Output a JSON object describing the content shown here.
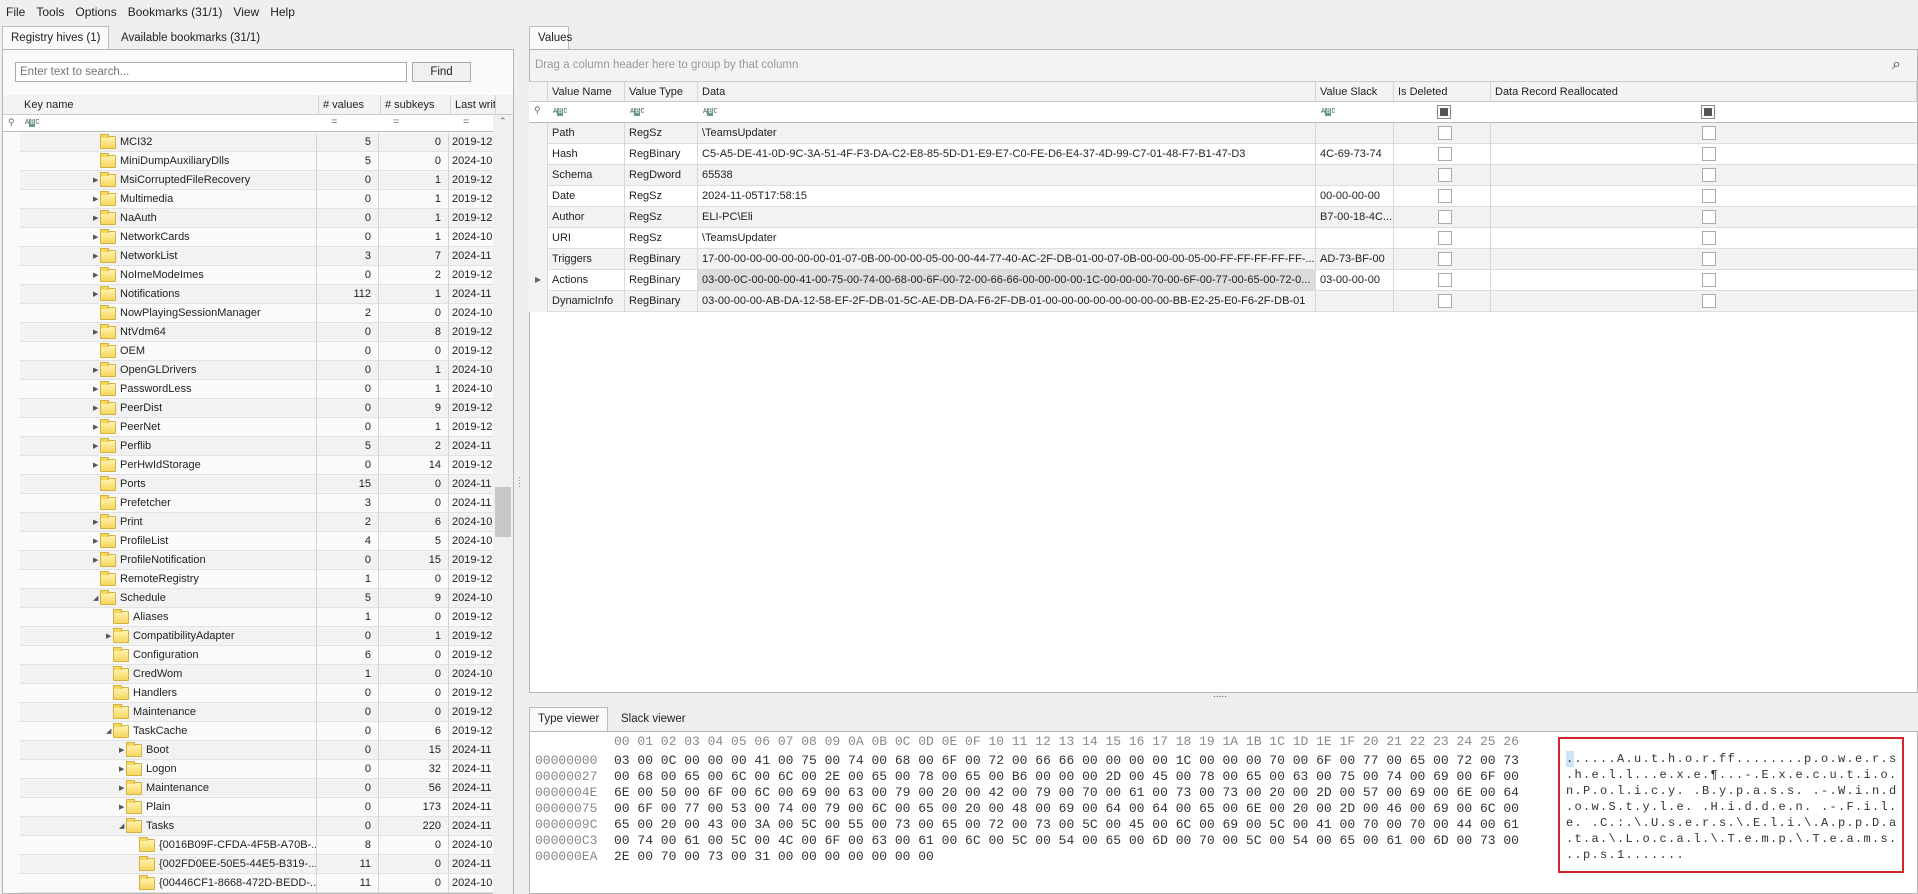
{
  "menu": [
    "File",
    "Tools",
    "Options",
    "Bookmarks (31/1)",
    "View",
    "Help"
  ],
  "left_tabs": {
    "hives": "Registry hives (1)",
    "bookmarks": "Available bookmarks (31/1)"
  },
  "search": {
    "placeholder": "Enter text to search...",
    "find_label": "Find"
  },
  "tree": {
    "columns": {
      "key_name": "Key name",
      "values": "# values",
      "subkeys": "# subkeys",
      "last_write": "Last write tim"
    },
    "filter_eq": "=",
    "rows": [
      {
        "level": 0,
        "exp": "none",
        "name": "MCI32",
        "values": "5",
        "subkeys": "0",
        "lw": "2019-12"
      },
      {
        "level": 0,
        "exp": "none",
        "name": "MiniDumpAuxiliaryDlls",
        "values": "5",
        "subkeys": "0",
        "lw": "2024-10"
      },
      {
        "level": 0,
        "exp": "collapsed",
        "name": "MsiCorruptedFileRecovery",
        "values": "0",
        "subkeys": "1",
        "lw": "2019-12"
      },
      {
        "level": 0,
        "exp": "collapsed",
        "name": "Multimedia",
        "values": "0",
        "subkeys": "1",
        "lw": "2019-12"
      },
      {
        "level": 0,
        "exp": "collapsed",
        "name": "NaAuth",
        "values": "0",
        "subkeys": "1",
        "lw": "2019-12"
      },
      {
        "level": 0,
        "exp": "collapsed",
        "name": "NetworkCards",
        "values": "0",
        "subkeys": "1",
        "lw": "2024-10"
      },
      {
        "level": 0,
        "exp": "collapsed",
        "name": "NetworkList",
        "values": "3",
        "subkeys": "7",
        "lw": "2024-11"
      },
      {
        "level": 0,
        "exp": "collapsed",
        "name": "NoImeModeImes",
        "values": "0",
        "subkeys": "2",
        "lw": "2019-12"
      },
      {
        "level": 0,
        "exp": "collapsed",
        "name": "Notifications",
        "values": "112",
        "subkeys": "1",
        "lw": "2024-11"
      },
      {
        "level": 0,
        "exp": "none",
        "name": "NowPlayingSessionManager",
        "values": "2",
        "subkeys": "0",
        "lw": "2024-10"
      },
      {
        "level": 0,
        "exp": "collapsed",
        "name": "NtVdm64",
        "values": "0",
        "subkeys": "8",
        "lw": "2019-12"
      },
      {
        "level": 0,
        "exp": "none",
        "name": "OEM",
        "values": "0",
        "subkeys": "0",
        "lw": "2019-12"
      },
      {
        "level": 0,
        "exp": "collapsed",
        "name": "OpenGLDrivers",
        "values": "0",
        "subkeys": "1",
        "lw": "2024-10"
      },
      {
        "level": 0,
        "exp": "collapsed",
        "name": "PasswordLess",
        "values": "0",
        "subkeys": "1",
        "lw": "2024-10"
      },
      {
        "level": 0,
        "exp": "collapsed",
        "name": "PeerDist",
        "values": "0",
        "subkeys": "9",
        "lw": "2019-12"
      },
      {
        "level": 0,
        "exp": "collapsed",
        "name": "PeerNet",
        "values": "0",
        "subkeys": "1",
        "lw": "2019-12"
      },
      {
        "level": 0,
        "exp": "collapsed",
        "name": "Perflib",
        "values": "5",
        "subkeys": "2",
        "lw": "2024-11"
      },
      {
        "level": 0,
        "exp": "collapsed",
        "name": "PerHwIdStorage",
        "values": "0",
        "subkeys": "14",
        "lw": "2019-12"
      },
      {
        "level": 0,
        "exp": "none",
        "name": "Ports",
        "values": "15",
        "subkeys": "0",
        "lw": "2024-11"
      },
      {
        "level": 0,
        "exp": "none",
        "name": "Prefetcher",
        "values": "3",
        "subkeys": "0",
        "lw": "2024-11"
      },
      {
        "level": 0,
        "exp": "collapsed",
        "name": "Print",
        "values": "2",
        "subkeys": "6",
        "lw": "2024-10"
      },
      {
        "level": 0,
        "exp": "collapsed",
        "name": "ProfileList",
        "values": "4",
        "subkeys": "5",
        "lw": "2024-10"
      },
      {
        "level": 0,
        "exp": "collapsed",
        "name": "ProfileNotification",
        "values": "0",
        "subkeys": "15",
        "lw": "2019-12"
      },
      {
        "level": 0,
        "exp": "none",
        "name": "RemoteRegistry",
        "values": "1",
        "subkeys": "0",
        "lw": "2019-12"
      },
      {
        "level": 0,
        "exp": "expanded",
        "name": "Schedule",
        "values": "5",
        "subkeys": "9",
        "lw": "2024-10"
      },
      {
        "level": 1,
        "exp": "none",
        "name": "Aliases",
        "values": "1",
        "subkeys": "0",
        "lw": "2019-12"
      },
      {
        "level": 1,
        "exp": "collapsed",
        "name": "CompatibilityAdapter",
        "values": "0",
        "subkeys": "1",
        "lw": "2019-12"
      },
      {
        "level": 1,
        "exp": "none",
        "name": "Configuration",
        "values": "6",
        "subkeys": "0",
        "lw": "2019-12"
      },
      {
        "level": 1,
        "exp": "none",
        "name": "CredWom",
        "values": "1",
        "subkeys": "0",
        "lw": "2024-10"
      },
      {
        "level": 1,
        "exp": "none",
        "name": "Handlers",
        "values": "0",
        "subkeys": "0",
        "lw": "2019-12"
      },
      {
        "level": 1,
        "exp": "none",
        "name": "Maintenance",
        "values": "0",
        "subkeys": "0",
        "lw": "2019-12"
      },
      {
        "level": 1,
        "exp": "expanded",
        "name": "TaskCache",
        "values": "0",
        "subkeys": "6",
        "lw": "2019-12"
      },
      {
        "level": 2,
        "exp": "collapsed",
        "name": "Boot",
        "values": "0",
        "subkeys": "15",
        "lw": "2024-11"
      },
      {
        "level": 2,
        "exp": "collapsed",
        "name": "Logon",
        "values": "0",
        "subkeys": "32",
        "lw": "2024-11"
      },
      {
        "level": 2,
        "exp": "collapsed",
        "name": "Maintenance",
        "values": "0",
        "subkeys": "56",
        "lw": "2024-11"
      },
      {
        "level": 2,
        "exp": "collapsed",
        "name": "Plain",
        "values": "0",
        "subkeys": "173",
        "lw": "2024-11"
      },
      {
        "level": 2,
        "exp": "expanded",
        "name": "Tasks",
        "values": "0",
        "subkeys": "220",
        "lw": "2024-11"
      },
      {
        "level": 3,
        "exp": "none",
        "name": "{0016B09F-CFDA-4F5B-A70B-...",
        "values": "8",
        "subkeys": "0",
        "lw": "2024-10"
      },
      {
        "level": 3,
        "exp": "none",
        "name": "{002FD0EE-50E5-44E5-B319-...",
        "values": "11",
        "subkeys": "0",
        "lw": "2024-11"
      },
      {
        "level": 3,
        "exp": "none",
        "name": "{00446CF1-8668-472D-BEDD-...",
        "values": "11",
        "subkeys": "0",
        "lw": "2024-10"
      }
    ]
  },
  "values_tab": "Values",
  "group_hint": "Drag a column header here to group by that column",
  "values": {
    "columns": {
      "name": "Value Name",
      "type": "Value Type",
      "data": "Data",
      "slack": "Value Slack",
      "deleted": "Is Deleted",
      "realloc": "Data Record Reallocated"
    },
    "selected_index": 7,
    "rows": [
      {
        "name": "Path",
        "type": "RegSz",
        "data": "\\TeamsUpdater",
        "slack": "",
        "deleted": false,
        "realloc": false
      },
      {
        "name": "Hash",
        "type": "RegBinary",
        "data": "C5-A5-DE-41-0D-9C-3A-51-4F-F3-DA-C2-E8-85-5D-D1-E9-E7-C0-FE-D6-E4-37-4D-99-C7-01-48-F7-B1-47-D3",
        "slack": "4C-69-73-74",
        "deleted": false,
        "realloc": false
      },
      {
        "name": "Schema",
        "type": "RegDword",
        "data": "65538",
        "slack": "",
        "deleted": false,
        "realloc": false
      },
      {
        "name": "Date",
        "type": "RegSz",
        "data": "2024-11-05T17:58:15",
        "slack": "00-00-00-00",
        "deleted": false,
        "realloc": false
      },
      {
        "name": "Author",
        "type": "RegSz",
        "data": "ELI-PC\\Eli",
        "slack": "B7-00-18-4C...",
        "deleted": false,
        "realloc": false
      },
      {
        "name": "URI",
        "type": "RegSz",
        "data": "\\TeamsUpdater",
        "slack": "",
        "deleted": false,
        "realloc": false
      },
      {
        "name": "Triggers",
        "type": "RegBinary",
        "data": "17-00-00-00-00-00-00-00-01-07-0B-00-00-00-05-00-00-44-77-40-AC-2F-DB-01-00-07-0B-00-00-00-05-00-FF-FF-FF-FF-FF-...",
        "slack": "AD-73-BF-00",
        "deleted": false,
        "realloc": false
      },
      {
        "name": "Actions",
        "type": "RegBinary",
        "data": "03-00-0C-00-00-00-41-00-75-00-74-00-68-00-6F-00-72-00-66-66-00-00-00-00-1C-00-00-00-70-00-6F-00-77-00-65-00-72-0...",
        "slack": "03-00-00-00",
        "deleted": false,
        "realloc": false
      },
      {
        "name": "DynamicInfo",
        "type": "RegBinary",
        "data": "03-00-00-00-AB-DA-12-58-EF-2F-DB-01-5C-AE-DB-DA-F6-2F-DB-01-00-00-00-00-00-00-00-00-BB-E2-25-E0-F6-2F-DB-01",
        "slack": "",
        "deleted": false,
        "realloc": false
      }
    ]
  },
  "splitter_dots": ".....",
  "bottom_tabs": {
    "type_viewer": "Type viewer",
    "slack_viewer": "Slack viewer"
  },
  "hex": {
    "header": "00 01 02 03 04 05 06 07 08 09 0A 0B 0C 0D 0E 0F 10 11 12 13 14 15 16 17 18 19 1A 1B 1C 1D 1E 1F 20 21 22 23 24 25 26",
    "rows": [
      {
        "offset": "00000000",
        "bytes": "03 00 0C 00 00 00 41 00 75 00 74 00 68 00 6F 00 72 00 66 66 00 00 00 00 1C 00 00 00 70 00 6F 00 77 00 65 00 72 00 73"
      },
      {
        "offset": "00000027",
        "bytes": "00 68 00 65 00 6C 00 6C 00 2E 00 65 00 78 00 65 00 B6 00 00 00 2D 00 45 00 78 00 65 00 63 00 75 00 74 00 69 00 6F 00"
      },
      {
        "offset": "0000004E",
        "bytes": "6E 00 50 00 6F 00 6C 00 69 00 63 00 79 00 20 00 42 00 79 00 70 00 61 00 73 00 73 00 20 00 2D 00 57 00 69 00 6E 00 64"
      },
      {
        "offset": "00000075",
        "bytes": "00 6F 00 77 00 53 00 74 00 79 00 6C 00 65 00 20 00 48 00 69 00 64 00 64 00 65 00 6E 00 20 00 2D 00 46 00 69 00 6C 00"
      },
      {
        "offset": "0000009C",
        "bytes": "65 00 20 00 43 00 3A 00 5C 00 55 00 73 00 65 00 72 00 73 00 5C 00 45 00 6C 00 69 00 5C 00 41 00 70 00 70 00 44 00 61"
      },
      {
        "offset": "000000C3",
        "bytes": "00 74 00 61 00 5C 00 4C 00 6F 00 63 00 61 00 6C 00 5C 00 54 00 65 00 6D 00 70 00 5C 00 54 00 65 00 61 00 6D 00 73 00"
      },
      {
        "offset": "000000EA",
        "bytes": "2E 00 70 00 73 00 31 00 00 00 00 00 00 00"
      }
    ],
    "ascii": [
      "......A.u.t.h.o.r.ff........p.o.w.e.r.s",
      ".h.e.l.l...e.x.e.¶...-.E.x.e.c.u.t.i.o.",
      "n.P.o.l.i.c.y. .B.y.p.a.s.s. .-.W.i.n.d",
      ".o.w.S.t.y.l.e. .H.i.d.d.e.n. .-.F.i.l.",
      "e. .C.:.\\.U.s.e.r.s.\\.E.l.i.\\.A.p.p.D.a",
      ".t.a.\\.L.o.c.a.l.\\.T.e.m.p.\\.T.e.a.m.s.",
      "..p.s.1......."
    ]
  },
  "colors": {
    "highlight_border": "#d0262b",
    "folder": "#f6d660",
    "filter_icon": "#6a9a86"
  }
}
